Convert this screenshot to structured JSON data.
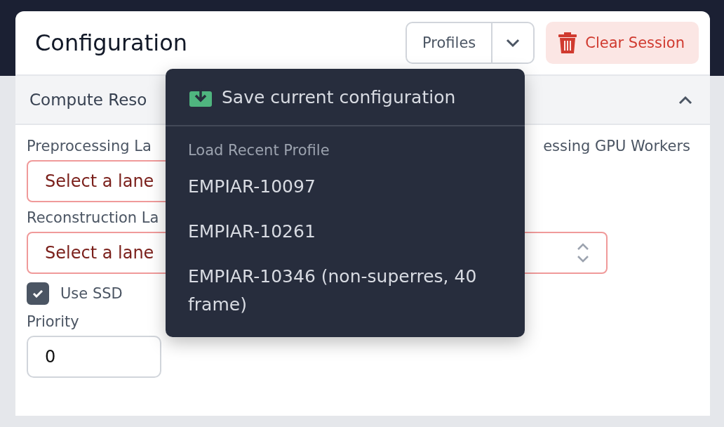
{
  "header": {
    "title": "Configuration",
    "profiles_button": "Profiles",
    "clear_button": "Clear Session"
  },
  "section": {
    "title": "Compute Reso",
    "expanded": true
  },
  "preprocessing": {
    "label": "Preprocessing La",
    "select": "Select a lane"
  },
  "gpu_workers": {
    "label": "essing GPU Workers"
  },
  "reconstruction": {
    "label": "Reconstruction La",
    "select": "Select a lane"
  },
  "use_ssd": {
    "label": "Use SSD",
    "checked": true
  },
  "priority": {
    "label": "Priority",
    "value": "0"
  },
  "profiles_menu": {
    "save_label": "Save current configuration",
    "group_label": "Load Recent Profile",
    "profiles": [
      "EMPIAR-10097",
      "EMPIAR-10261",
      "EMPIAR-10346 (non-superres, 40 frame)"
    ]
  }
}
